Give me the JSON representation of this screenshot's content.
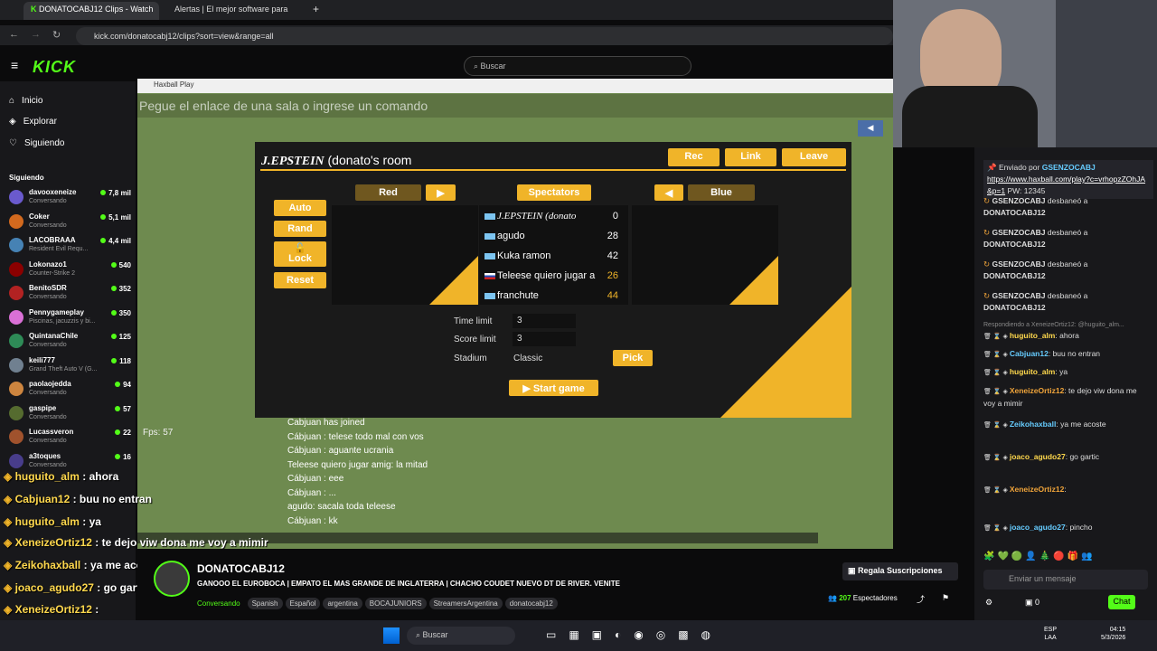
{
  "browser": {
    "tabs": [
      {
        "label": "DONATOCABJ12 Clips - Watch",
        "active": true
      },
      {
        "label": "Alertas | El mejor software para",
        "active": false
      }
    ],
    "url": "kick.com/donatocabj12/clips?sort=view&range=all"
  },
  "kick": {
    "logo": "KICK",
    "search_placeholder": "Buscar",
    "nav": [
      {
        "label": "Inicio",
        "icon": "home-icon"
      },
      {
        "label": "Explorar",
        "icon": "compass-icon"
      },
      {
        "label": "Siguiendo",
        "icon": "heart-icon"
      }
    ],
    "following_title": "Siguiendo",
    "following": [
      {
        "name": "davooxeneize",
        "status": "Conversando",
        "viewers": "7,8 mil"
      },
      {
        "name": "Coker",
        "status": "Conversando",
        "viewers": "5,1 mil"
      },
      {
        "name": "LACOBRAAA",
        "status": "Resident Evil Requ...",
        "viewers": "4,4 mil"
      },
      {
        "name": "Lokonazo1",
        "status": "Counter-Strike 2",
        "viewers": "540"
      },
      {
        "name": "BenitoSDR",
        "status": "Conversando",
        "viewers": "352"
      },
      {
        "name": "Pennygameplay",
        "status": "Piscinas, jacuzzis y bi...",
        "viewers": "350"
      },
      {
        "name": "QuintanaChile",
        "status": "Conversando",
        "viewers": "125"
      },
      {
        "name": "keili777",
        "status": "Grand Theft Auto V (G...",
        "viewers": "118"
      },
      {
        "name": "paolaojedda",
        "status": "Conversando",
        "viewers": "94"
      },
      {
        "name": "gaspipe",
        "status": "Conversando",
        "viewers": "57"
      },
      {
        "name": "Lucassveron",
        "status": "Conversando",
        "viewers": "22"
      },
      {
        "name": "a3toques",
        "status": "Conversando",
        "viewers": "16"
      }
    ]
  },
  "game": {
    "window_title": "Haxball Play",
    "cmd_placeholder": "Pegue el enlace de una sala o ingrese un comando",
    "room_title_bold": "J.EPSTEIN",
    "room_title_rest": "(donato's room",
    "rec": "Rec",
    "link": "Link",
    "leave": "Leave",
    "auto": "Auto",
    "rand": "Rand",
    "lock": "Lock",
    "reset": "Reset",
    "red": "Red",
    "spectators": "Spectators",
    "blue": "Blue",
    "spectator_list": [
      {
        "name": "J.EPSTEIN (donato",
        "score": "0"
      },
      {
        "name": "agudo",
        "score": "28"
      },
      {
        "name": "Kuka ramon",
        "score": "42"
      },
      {
        "name": "Teleese quiero jugar a",
        "score": "26"
      },
      {
        "name": "franchute",
        "score": "44"
      }
    ],
    "time_limit_label": "Time limit",
    "time_limit": "3",
    "score_limit_label": "Score limit",
    "score_limit": "3",
    "stadium_label": "Stadium",
    "stadium": "Classic",
    "pick": "Pick",
    "start": "Start game",
    "fps": "Fps: 57",
    "chat": [
      "Cabjuan has joined",
      "Cábjuan : telese todo mal con vos",
      "Cábjuan : aguante ucrania",
      "Teleese quiero jugar amig: la mitad",
      "Cábjuan : eee",
      "Cábjuan : ...",
      "agudo: sacala toda teleese",
      "Cábjuan : kk"
    ]
  },
  "kickchat": {
    "pinned_by": "Enviado por",
    "pinned_user": "GSENZOCABJ",
    "pinned_link": "https://www.haxball.com/play?c=vrhopzZOhJA&p=1",
    "pinned_pw": "PW: 12345",
    "unban": [
      {
        "user": "GSENZOCABJ",
        "text": "desbaneó a",
        "target": "DONATOCABJ12"
      },
      {
        "user": "GSENZOCABJ",
        "text": "desbaneó a",
        "target": "DONATOCABJ12"
      },
      {
        "user": "GSENZOCABJ",
        "text": "desbaneó a",
        "target": "DONATOCABJ12"
      },
      {
        "user": "GSENZOCABJ",
        "text": "desbaneó a",
        "target": "DONATOCABJ12"
      }
    ],
    "reply_to": "Respondiendo a XeneizeOrtiz12: @huguito_alm...",
    "messages": [
      {
        "user": "huguito_alm",
        "text": "ahora"
      },
      {
        "user": "Cabjuan12",
        "text": "buu no entran"
      },
      {
        "user": "huguito_alm",
        "text": "ya"
      },
      {
        "user": "XeneizeOrtiz12",
        "text": "te dejo viw dona me voy a mimir"
      },
      {
        "user": "Zeikohaxball",
        "text": "ya me acoste"
      },
      {
        "user": "joaco_agudo27",
        "text": "go gartic"
      },
      {
        "user": "XeneizeOrtiz12",
        "text": ""
      },
      {
        "user": "joaco_agudo27",
        "text": "pincho"
      }
    ],
    "input_placeholder": "Enviar un mensaje",
    "count": "0",
    "chat_button": "Chat"
  },
  "overlay": [
    {
      "user": "huguito_alm",
      "text": "ahora"
    },
    {
      "user": "Cabjuan12",
      "text": "buu no entran"
    },
    {
      "user": "huguito_alm",
      "text": "ya"
    },
    {
      "user": "XeneizeOrtiz12",
      "text": "te dejo viw dona me voy a mimir"
    },
    {
      "user": "Zeikohaxball",
      "text": "ya me acoste"
    },
    {
      "user": "joaco_agudo27",
      "text": "go gartic"
    },
    {
      "user": "XeneizeOrtiz12",
      "text": ""
    },
    {
      "user": "joaco_agudo27",
      "text": "pincho"
    }
  ],
  "stream": {
    "channel": "DONATOCABJ12",
    "title": "GANOOO EL EUROBOCA | EMPATO EL MAS GRANDE DE INGLATERRA | CHACHO COUDET NUEVO DT DE RIVER. VENITE",
    "tags": [
      "Conversando",
      "Spanish",
      "Español",
      "argentina",
      "BOCAJUNIORS",
      "StreamersArgentina",
      "donatocabj12"
    ],
    "subs_button": "Regala Suscripciones",
    "viewers": "207",
    "viewers_label": "Espectadores"
  },
  "taskbar": {
    "search": "Buscar",
    "lang": "ESP",
    "lang2": "LAA",
    "time": "04:15",
    "date": "5/3/2026"
  }
}
